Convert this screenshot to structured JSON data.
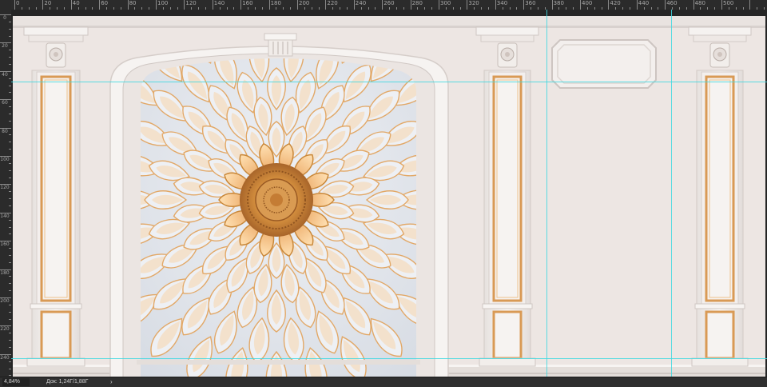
{
  "ruler": {
    "top_labels": [
      "0",
      "20",
      "40",
      "60",
      "80",
      "100",
      "120",
      "140",
      "160",
      "180",
      "200",
      "220",
      "240",
      "260",
      "280",
      "300",
      "320",
      "340",
      "360",
      "380",
      "400",
      "420",
      "440",
      "460",
      "480",
      "500"
    ],
    "left_labels": [
      "0",
      "20",
      "40",
      "60",
      "80",
      "100",
      "120",
      "140",
      "160",
      "180",
      "200",
      "220",
      "240"
    ]
  },
  "status": {
    "zoom": "4,84%",
    "doc_size": "Док: 1,24Г/1,88Г",
    "menu_arrow": "›"
  },
  "artwork": {
    "wall_color": "#ede6e3",
    "molding_color": "#f4f1ef",
    "gold_color": "#d79a52",
    "petal_color": "#dfe3ea",
    "center_color": "#c9883a"
  }
}
